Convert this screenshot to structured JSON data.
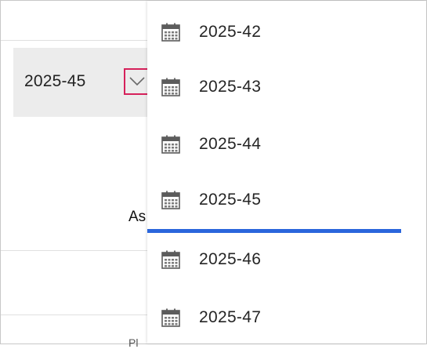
{
  "week_selector": {
    "value": "2025-45",
    "dropdown_icon": "chevron-down-icon",
    "highlight_color": "#d6215b"
  },
  "background_fragments": {
    "column_header_partial": "As",
    "bottom_partial": "Pl"
  },
  "dropdown": {
    "item_icon": "calendar-icon",
    "selected_value": "2025-45",
    "selected_indicator_color": "#2a66dc",
    "options": [
      {
        "label": "2025-42"
      },
      {
        "label": "2025-43"
      },
      {
        "label": "2025-44"
      },
      {
        "label": "2025-45"
      },
      {
        "label": "2025-46"
      },
      {
        "label": "2025-47"
      }
    ]
  }
}
